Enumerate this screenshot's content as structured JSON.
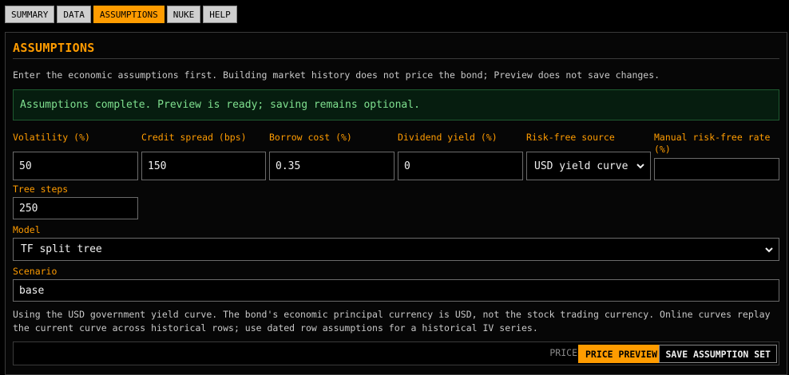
{
  "tabs": [
    {
      "label": "SUMMARY"
    },
    {
      "label": "DATA"
    },
    {
      "label": "ASSUMPTIONS"
    },
    {
      "label": "NUKE"
    },
    {
      "label": "HELP"
    }
  ],
  "active_tab": "ASSUMPTIONS",
  "panel": {
    "title": "ASSUMPTIONS",
    "intro": "Enter the economic assumptions first. Building market history does not price the bond; Preview does not save changes.",
    "notice": "Assumptions complete. Preview is ready; saving remains optional."
  },
  "fields": {
    "volatility": {
      "label": "Volatility (%)",
      "value": "50"
    },
    "credit_spread": {
      "label": "Credit spread (bps)",
      "value": "150"
    },
    "borrow_cost": {
      "label": "Borrow cost (%)",
      "value": "0.35"
    },
    "dividend_yield": {
      "label": "Dividend yield (%)",
      "value": "0"
    },
    "risk_free_source": {
      "label": "Risk-free source",
      "value": "USD yield curve"
    },
    "manual_rf": {
      "label_line1": "Manual risk-free rate",
      "label_line2": "(%)",
      "value": ""
    },
    "tree_steps": {
      "label": "Tree steps",
      "value": "250"
    },
    "model": {
      "label": "Model",
      "value": "TF split tree"
    },
    "scenario": {
      "label": "Scenario",
      "value": "base"
    }
  },
  "note": "Using the USD government yield curve. The bond's economic principal currency is USD, not the stock trading currency. Online curves replay the current curve across historical rows; use dated row assumptions for a historical IV series.",
  "actions": {
    "price_label": "PRICE",
    "preview_label": "PRICE PREVIEW",
    "save_label": "SAVE ASSUMPTION SET"
  },
  "colors": {
    "accent": "#ff9c00",
    "success_text": "#7fe08f",
    "success_bg": "#061d0f"
  }
}
